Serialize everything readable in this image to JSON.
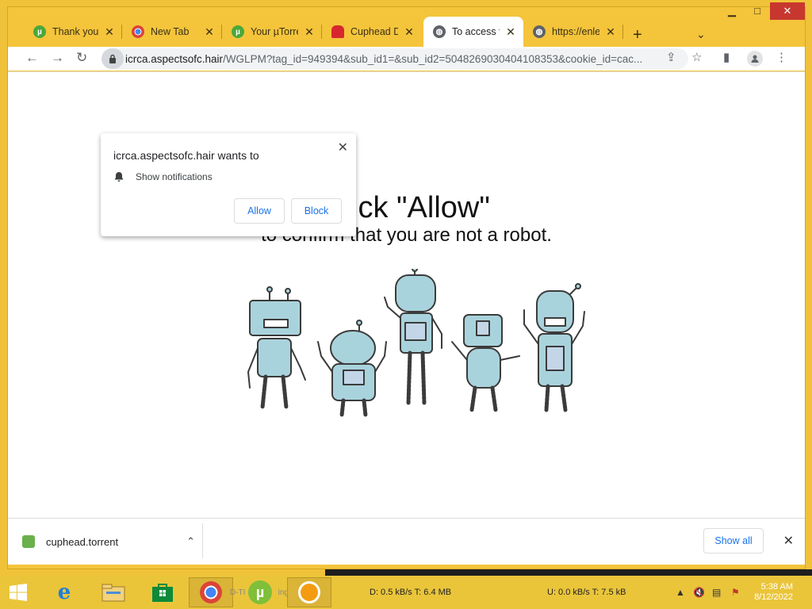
{
  "window": {
    "controls": {
      "minimize": "▁",
      "maximize": "□",
      "close": "✕"
    }
  },
  "tabs": [
    {
      "label": "Thank you f",
      "icon": "utorrent-icon"
    },
    {
      "label": "New Tab",
      "icon": "chrome-icon"
    },
    {
      "label": "Your µTorre",
      "icon": "utorrent-icon"
    },
    {
      "label": "Cuphead D",
      "icon": "ghost-icon"
    },
    {
      "label": "To access t",
      "icon": "globe-icon",
      "active": true
    },
    {
      "label": "https://enle",
      "icon": "globe-icon"
    }
  ],
  "toolbar": {
    "url_host": "icrca.aspectsofc.hair",
    "url_path": "/WGLPM?tag_id=949394&sub_id1=&sub_id2=5048269030404108353&cookie_id=cac..."
  },
  "popup": {
    "title": "icrca.aspectsofc.hair wants to",
    "permission": "Show notifications",
    "allow": "Allow",
    "block": "Block"
  },
  "page": {
    "headline": "Click \"Allow\"",
    "subline": "to confirm that you are not a robot."
  },
  "download": {
    "filename": "cuphead.torrent",
    "show_all": "Show all"
  },
  "taskbar": {
    "task_label": "D-TI",
    "task_label2": "ing",
    "download_stat": "D: 0.5 kB/s T: 6.4 MB",
    "upload_stat": "U: 0.0 kB/s T: 7.5 kB",
    "time": "5:38 AM",
    "date": "8/12/2022"
  },
  "colors": {
    "frame": "#f4c43b",
    "link_blue": "#1a73e8",
    "robot_fill": "#a9d3dc"
  }
}
